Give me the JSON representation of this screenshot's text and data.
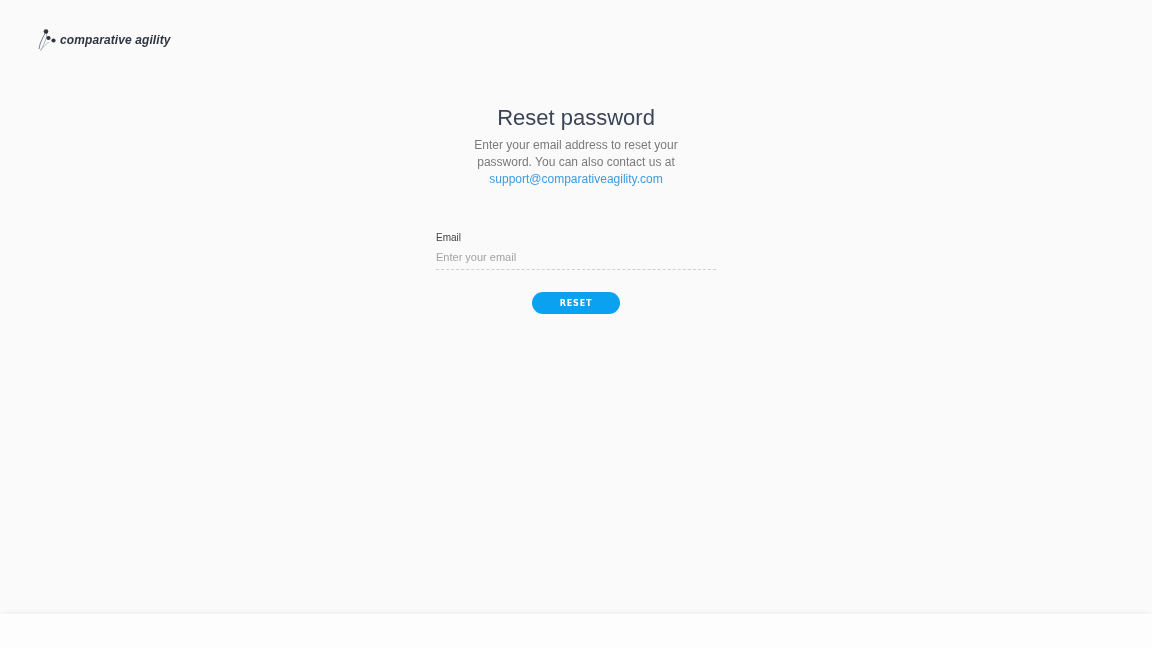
{
  "logo": {
    "text": "comparative agility"
  },
  "title": "Reset password",
  "intro": {
    "text": "Enter your email address to reset your password. You can also contact us at",
    "link": "support@comparativeagility.com"
  },
  "form": {
    "fields": [
      {
        "label": "Email",
        "placeholder": "Enter your email"
      }
    ],
    "submit": "RESET"
  }
}
